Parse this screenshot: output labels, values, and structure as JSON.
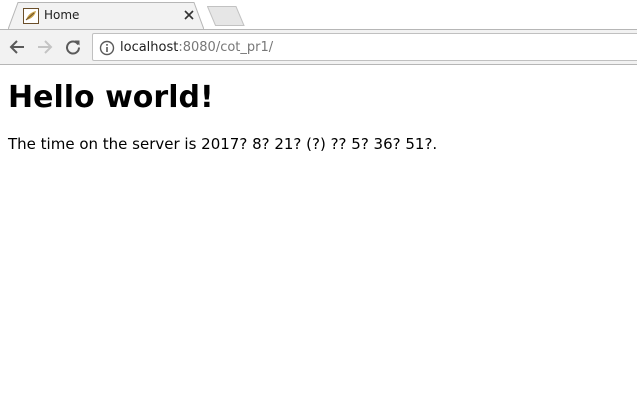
{
  "browser": {
    "tab": {
      "title": "Home"
    },
    "address": {
      "host": "localhost",
      "rest": ":8080/cot_pr1/"
    }
  },
  "page": {
    "heading": "Hello world!",
    "server_time_text": "The time on the server is 2017? 8? 21? (?) ?? 5? 36? 51?."
  },
  "icons": {
    "favicon": "leaf-favicon-icon",
    "close": "close-icon",
    "back": "back-arrow-icon",
    "forward": "forward-arrow-icon",
    "reload": "reload-icon",
    "info": "info-icon"
  }
}
